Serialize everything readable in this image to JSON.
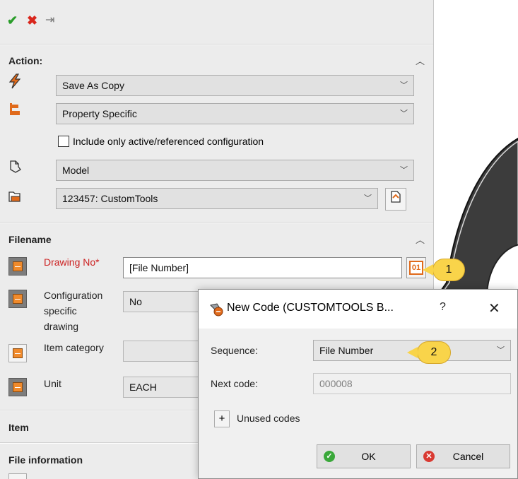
{
  "toolbar": {
    "ok_icon": "check-icon",
    "cancel_icon": "close-icon",
    "pin_icon": "pushpin-icon",
    "ok_glyph": "✔",
    "cancel_glyph": "✖",
    "pin_glyph": "⇥",
    "ok_color": "#2a9d2a",
    "cancel_color": "#d9261c"
  },
  "action": {
    "title": "Action:",
    "save_mode": "Save As Copy",
    "property_mode": "Property Specific",
    "include_active_label": "Include only active/referenced configuration",
    "include_active_checked": false,
    "model_type": "Model",
    "project": "123457: CustomTools"
  },
  "filename": {
    "title": "Filename",
    "drawing_no_label": "Drawing No*",
    "drawing_no_value": "[File Number]",
    "generate_badge": "01",
    "config_label_1": "Configuration",
    "config_label_2": "specific",
    "config_label_3": "drawing",
    "config_value": "No",
    "item_category_label": "Item category",
    "item_category_value": "",
    "unit_label": "Unit",
    "unit_value": "EACH"
  },
  "item_section": {
    "title": "Item"
  },
  "file_info_section": {
    "title": "File information"
  },
  "callouts": {
    "first": "1",
    "second": "2"
  },
  "dialog": {
    "title": "New Code (CUSTOMTOOLS B...",
    "help": "?",
    "close": "✕",
    "sequence_label": "Sequence:",
    "sequence_value": "File Number",
    "next_code_label": "Next code:",
    "next_code_value": "000008",
    "unused_toggle": "+",
    "unused_label": "Unused codes",
    "ok_label": "OK",
    "cancel_label": "Cancel",
    "ok_color": "#3aa83a",
    "cancel_color": "#d93a32"
  },
  "colors": {
    "accent_orange": "#e06a1b",
    "required_red": "#cc2222",
    "callout_yellow": "#f9d44a"
  }
}
